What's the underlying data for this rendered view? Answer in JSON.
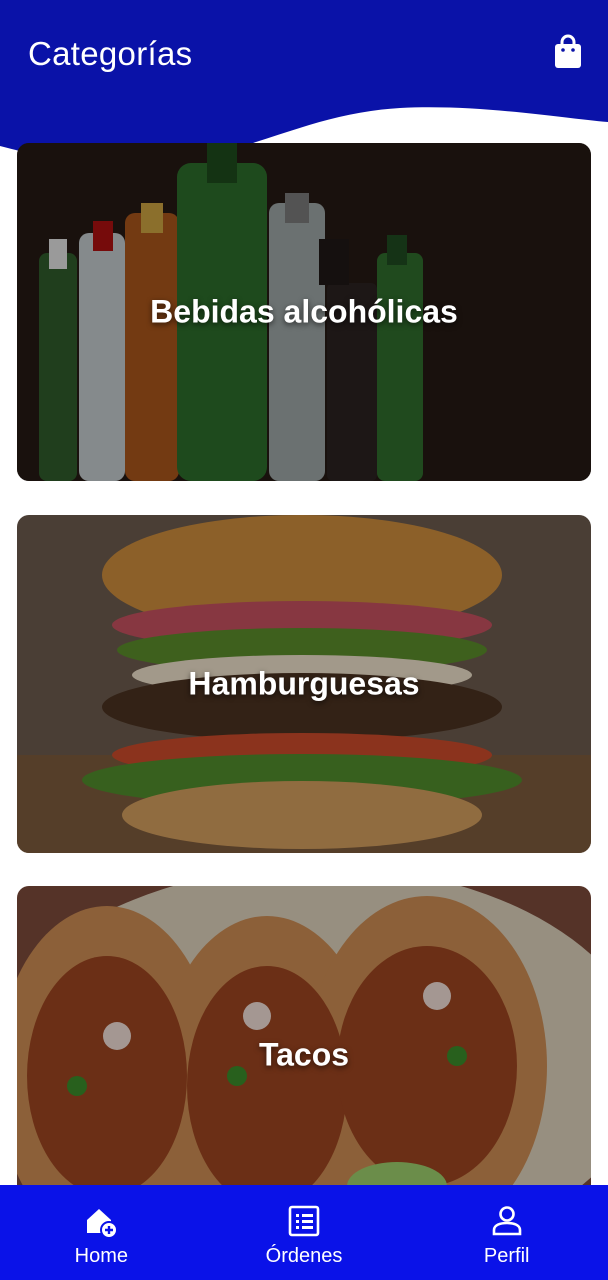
{
  "header": {
    "title": "Categorías",
    "cart_icon": "shopping-bag-icon"
  },
  "categories": [
    {
      "label": "Bebidas alcohólicas",
      "image": "liquor-bottles-photo"
    },
    {
      "label": "Hamburguesas",
      "image": "burger-photo"
    },
    {
      "label": "Tacos",
      "image": "tacos-photo"
    }
  ],
  "nav": {
    "items": [
      {
        "label": "Home",
        "icon": "home-add-icon"
      },
      {
        "label": "Órdenes",
        "icon": "list-icon"
      },
      {
        "label": "Perfil",
        "icon": "person-icon"
      }
    ]
  },
  "colors": {
    "header": "#0a12a8",
    "nav": "#0a12e8",
    "text": "#ffffff"
  }
}
